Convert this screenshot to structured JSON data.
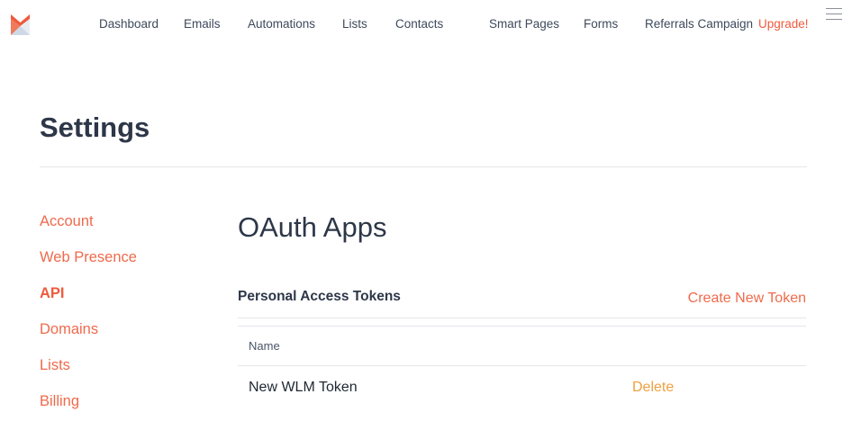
{
  "nav": {
    "items": [
      {
        "label": "Dashboard"
      },
      {
        "label": "Emails"
      },
      {
        "label": "Automations"
      },
      {
        "label": "Lists"
      },
      {
        "label": "Contacts"
      },
      {
        "label": "Smart Pages"
      },
      {
        "label": "Forms"
      },
      {
        "label": "Referrals Campaign"
      }
    ],
    "upgrade_label": "Upgrade!"
  },
  "icons": {
    "logo": "brand-logo-icon",
    "menu": "hamburger-menu-icon"
  },
  "colors": {
    "accent": "#ef5a3c",
    "delete": "#efa040",
    "text": "#2d3748"
  },
  "page": {
    "title": "Settings"
  },
  "sidebar": {
    "items": [
      {
        "label": "Account"
      },
      {
        "label": "Web Presence"
      },
      {
        "label": "API",
        "active": true
      },
      {
        "label": "Domains"
      },
      {
        "label": "Lists"
      },
      {
        "label": "Billing"
      }
    ]
  },
  "main": {
    "section_title": "OAuth Apps",
    "tokens": {
      "title": "Personal Access Tokens",
      "create_label": "Create New Token",
      "columns": [
        "Name"
      ],
      "rows": [
        {
          "name": "New WLM Token",
          "delete_label": "Delete"
        }
      ]
    }
  }
}
